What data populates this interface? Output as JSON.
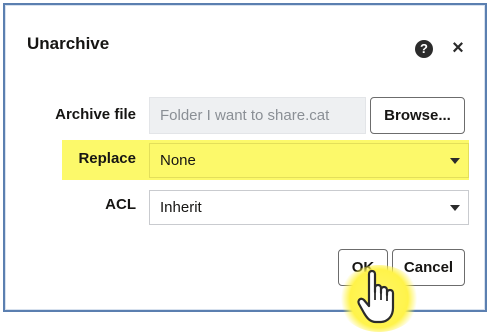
{
  "dialog": {
    "title": "Unarchive",
    "help_symbol": "?",
    "close_symbol": "×"
  },
  "form": {
    "archive_file": {
      "label": "Archive file",
      "value": "Folder I want to share.cat",
      "browse_label": "Browse..."
    },
    "replace": {
      "label": "Replace",
      "selected": "None"
    },
    "acl": {
      "label": "ACL",
      "selected": "Inherit"
    }
  },
  "buttons": {
    "ok_label": "OK",
    "cancel_label": "Cancel"
  },
  "colors": {
    "highlight": "#fcf96a",
    "frame_border": "#5b7fb0",
    "cursor_glow": "#fff34a"
  },
  "icons": {
    "help": "help-circle-icon",
    "close": "close-icon",
    "dropdown": "chevron-down-icon",
    "pointer": "hand-pointer-icon"
  }
}
